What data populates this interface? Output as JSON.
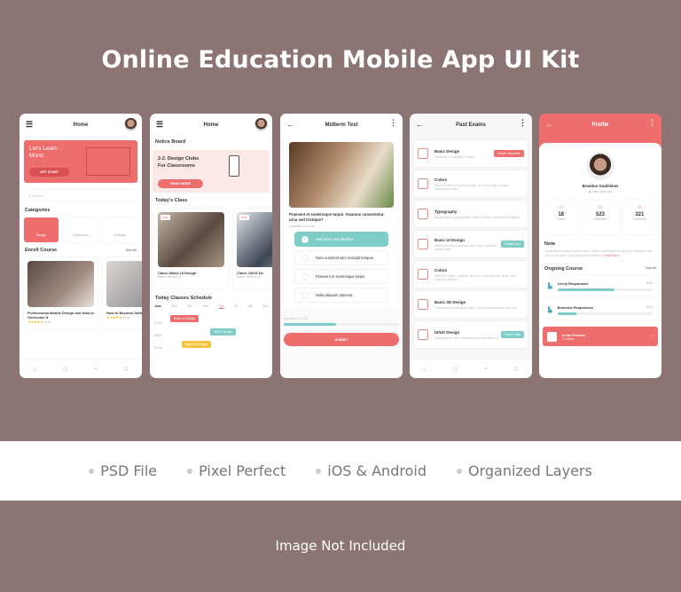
{
  "title": "Online Education Mobile App UI Kit",
  "colors": {
    "background": "#8c7474",
    "accent": "#ee6e6e",
    "teal": "#7ecdc8",
    "yellow": "#f5c542"
  },
  "screen1": {
    "header": "Home",
    "banner": {
      "title": "Let's Learn More!",
      "button": "GET START"
    },
    "search_placeholder": "Search",
    "categories_title": "Categories",
    "categories": [
      "Design",
      "Illustrations",
      "Software"
    ],
    "enroll_title": "Enroll Course",
    "see_all": "See All",
    "courses": [
      {
        "title": "Professional Mobile Design and How to Overcome it",
        "rating": "(4.8)"
      },
      {
        "title": "How to Become Software Devel",
        "rating": "(4.5)"
      }
    ],
    "nav": [
      "home-icon",
      "chat-icon",
      "bell-icon",
      "user-icon"
    ]
  },
  "screen2": {
    "header": "Home",
    "notice_title": "Notice Board",
    "notice": {
      "title": "2-2. Design Clubs For Classrooms",
      "button": "READ MORE"
    },
    "today_title": "Today's Class",
    "classes": [
      {
        "live": "LIVE",
        "title": "Class: Basic UI Design",
        "batch": "Batch: 60M (3.0)"
      },
      {
        "live": "LIVE",
        "title": "Class: UI/UX De",
        "batch": "Batch: 60M (3.0)"
      }
    ],
    "schedule_title": "Today Classes Schedule",
    "days": [
      "June",
      "Mon",
      "Tue",
      "Wed",
      "Thu",
      "Fri",
      "Sat",
      "Sun"
    ],
    "times": [
      "07:00",
      "08:00",
      "09:00"
    ],
    "events": [
      "Basic UI Design",
      "UI/UX Design",
      "Basic 3D Design"
    ]
  },
  "screen3": {
    "header": "Midterm Test",
    "question": "Praesent et scelerisque turpis. Vivamus consectetur, urna sed tristique?",
    "question_no": "Question 21 of 28",
    "options": [
      "Sed tortor and dapibus",
      "Nam euismod sem suscipit tempus",
      "Praesent et scelerisque turpis",
      "Nulla aliquam placerat"
    ],
    "selected": 0,
    "progress_label": "Question 21 of 28",
    "progress": 0.45,
    "submit": "SUBMIT"
  },
  "screen4": {
    "header": "Past Exams",
    "exams": [
      {
        "title": "Basic Design",
        "desc": "Introduction to graphic Design.",
        "badge": "Result Unpublish",
        "badge_type": "coral"
      },
      {
        "title": "Colors",
        "desc": "Etiam ac nibh a volutpat semper et auctor vitae, suscipit ullamcorper dolor.",
        "badge": "",
        "badge_type": ""
      },
      {
        "title": "Typography",
        "desc": "Suspendisse cursus dictum varius. Etiam a condimentum ligula.",
        "badge": "",
        "badge_type": ""
      },
      {
        "title": "Basic UI Design",
        "desc": "Maecenas non commodo sem. Etiam pharetra blandit dolor.",
        "badge": "Result View",
        "badge_type": "teal"
      },
      {
        "title": "Colors",
        "desc": "Sed tortor lorem, dapibus vel leo in, vulputate hac lacus. Nam euismod, tempus.",
        "badge": "",
        "badge_type": ""
      },
      {
        "title": "Basic 3D Design",
        "desc": "Praesent et scelerisque turpis. Vivamus consectetur, urna sed.",
        "badge": "",
        "badge_type": ""
      },
      {
        "title": "UI/UX Design",
        "desc": "Nulla aliquam, nec malesuada nulla faucibus et.",
        "badge": "Result View",
        "badge_type": "teal"
      }
    ]
  },
  "screen5": {
    "header": "Profile",
    "name": "Brandon Guidelines",
    "location": "New York City",
    "stats": [
      {
        "value": "18",
        "label": "Rank"
      },
      {
        "value": "523",
        "label": "Followers"
      },
      {
        "value": "321",
        "label": "Following"
      }
    ],
    "note_title": "Note",
    "note": "Suspendisse cursus dictum varius. Etiam a condimentum ligula, in bibendum nisi. Cras a velit sem. Quisq tincidunt sodales est",
    "read_more": "Read More...",
    "ongoing_title": "Ongoing Course",
    "view_all": "View All",
    "courses": [
      {
        "title": "Lively Responsive",
        "percent": "60%",
        "progress": 0.6
      },
      {
        "title": "Benedict Responsive",
        "percent": "32%",
        "progress": 0.2
      }
    ],
    "invite": {
      "title": "Invite Friends",
      "sub": "Complete"
    }
  },
  "features": [
    "PSD File",
    "Pixel Perfect",
    "iOS & Android",
    "Organized Layers"
  ],
  "footer": "Image Not Included"
}
